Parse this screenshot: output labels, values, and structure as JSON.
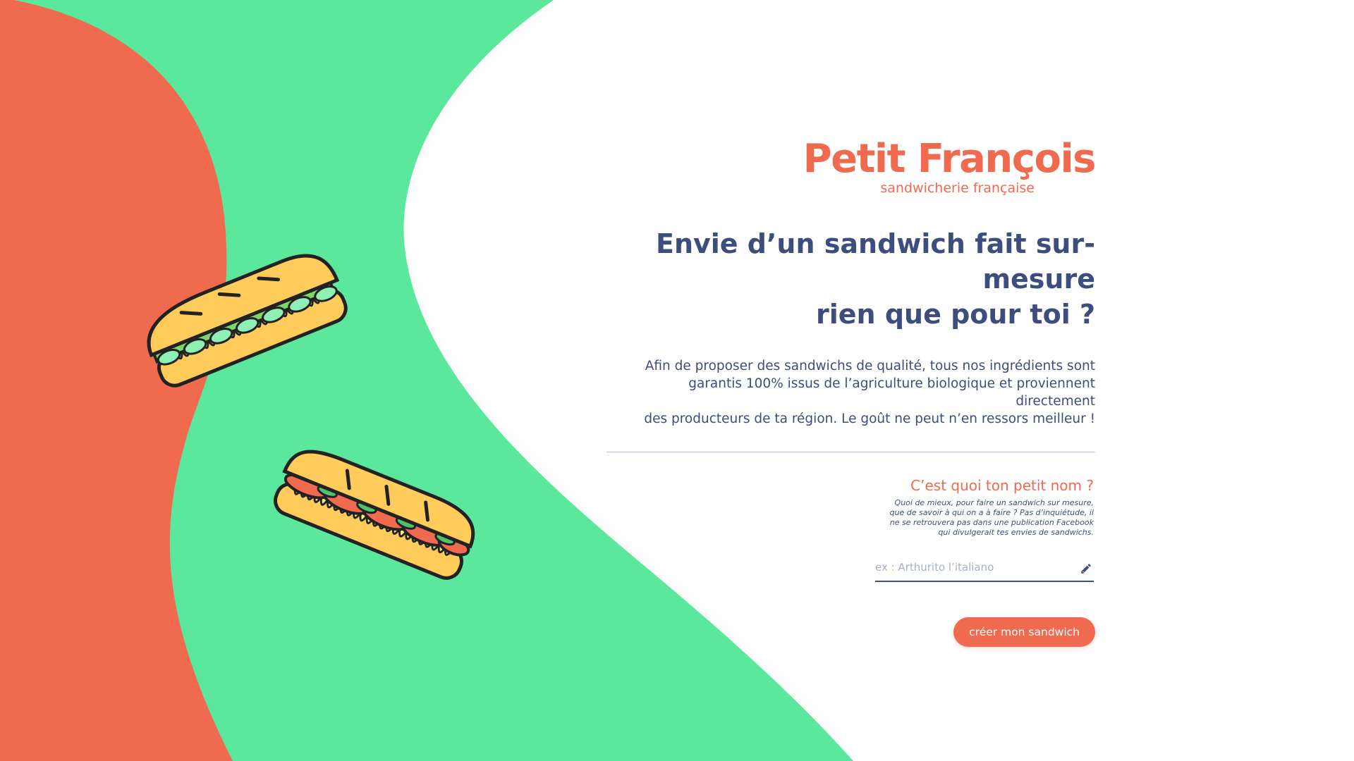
{
  "brand": {
    "title": "Petit François",
    "subtitle": "sandwicherie française"
  },
  "hero": {
    "headline_line1": "Envie d’un sandwich fait sur-mesure",
    "headline_line2": "rien que pour toi ?",
    "intro_line1": "Afin de proposer des sandwichs de qualité, tous nos ingrédients sont",
    "intro_line2": "garantis 100% issus de l’agriculture biologique et proviennent directement",
    "intro_line3": "des producteurs de ta région. Le goût ne peut n’en ressors meilleur !"
  },
  "form": {
    "question": "C’est quoi ton petit nom ?",
    "note_line1": "Quoi de mieux, pour faire un sandwich sur mesure,",
    "note_line2": "que de savoir à qui on a à faire ? Pas d’inquiétude, il",
    "note_line3": "ne se retrouvera pas dans une publication Facebook",
    "note_line4": "qui divulgerait tes envies de sandwichs.",
    "name_placeholder": "ex : Arthurito l’italiano",
    "name_value": "",
    "submit_label": "créer mon sandwich"
  },
  "icons": {
    "edit": "pencil-icon",
    "illustration_1": "sandwich-lettuce-icon",
    "illustration_2": "sandwich-tomato-icon"
  },
  "colors": {
    "coral": "#f06a50",
    "green": "#5be89c",
    "navy": "#3d4d7e",
    "bread": "#ffcc5c"
  }
}
